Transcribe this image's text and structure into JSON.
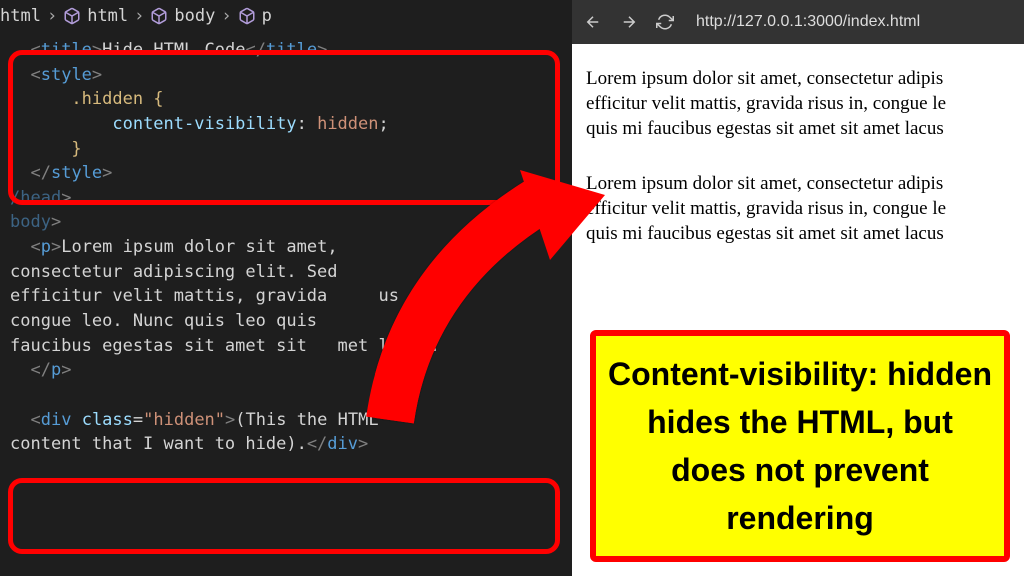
{
  "breadcrumb": {
    "item0": "html",
    "item1": "html",
    "item2": "body",
    "item3": "p"
  },
  "code": {
    "title_open": "<title>",
    "title_text": "Hide HTML Code",
    "title_close": "</title>",
    "style_open": "<style>",
    "selector": ".hidden {",
    "prop": "content-visibility",
    "colon": ": ",
    "value": "hidden",
    "semi": ";",
    "brace_close": "}",
    "style_close": "</style>",
    "head_close": "/head",
    "body_open": "body",
    "p_open": "<p>",
    "para_l1": "Lorem ipsum dolor sit amet,",
    "para_l2": "consectetur adipiscing elit. Sed",
    "para_l3a": "efficitur velit mattis, gravida ",
    "para_l3b": "us in,",
    "para_l4": "congue leo. Nunc quis leo quis",
    "para_l5a": "faucibus egestas sit amet sit ",
    "para_l5b": "met lacus.",
    "p_close": "</p>",
    "div_open_tag": "div",
    "div_attr": "class",
    "div_attrval": "\"hidden\"",
    "div_text_l1": "(This the HTML",
    "div_text_l2": "content that I want to hide).",
    "div_close": "</div>"
  },
  "browser": {
    "url": "http://127.0.0.1:3000/index.html"
  },
  "page": {
    "p1_l1": "Lorem ipsum dolor sit amet, consectetur adipis",
    "p1_l2": "efficitur velit mattis, gravida risus in, congue le",
    "p1_l3": "quis mi faucibus egestas sit amet sit amet lacus",
    "p2_l1": "Lorem ipsum dolor sit amet, consectetur adipis",
    "p2_l2": "efficitur velit mattis, gravida risus in, congue le",
    "p2_l3": "quis mi faucibus egestas sit amet sit amet lacus"
  },
  "callout": {
    "text": "Content-visibility: hidden hides the HTML, but does not prevent rendering"
  }
}
